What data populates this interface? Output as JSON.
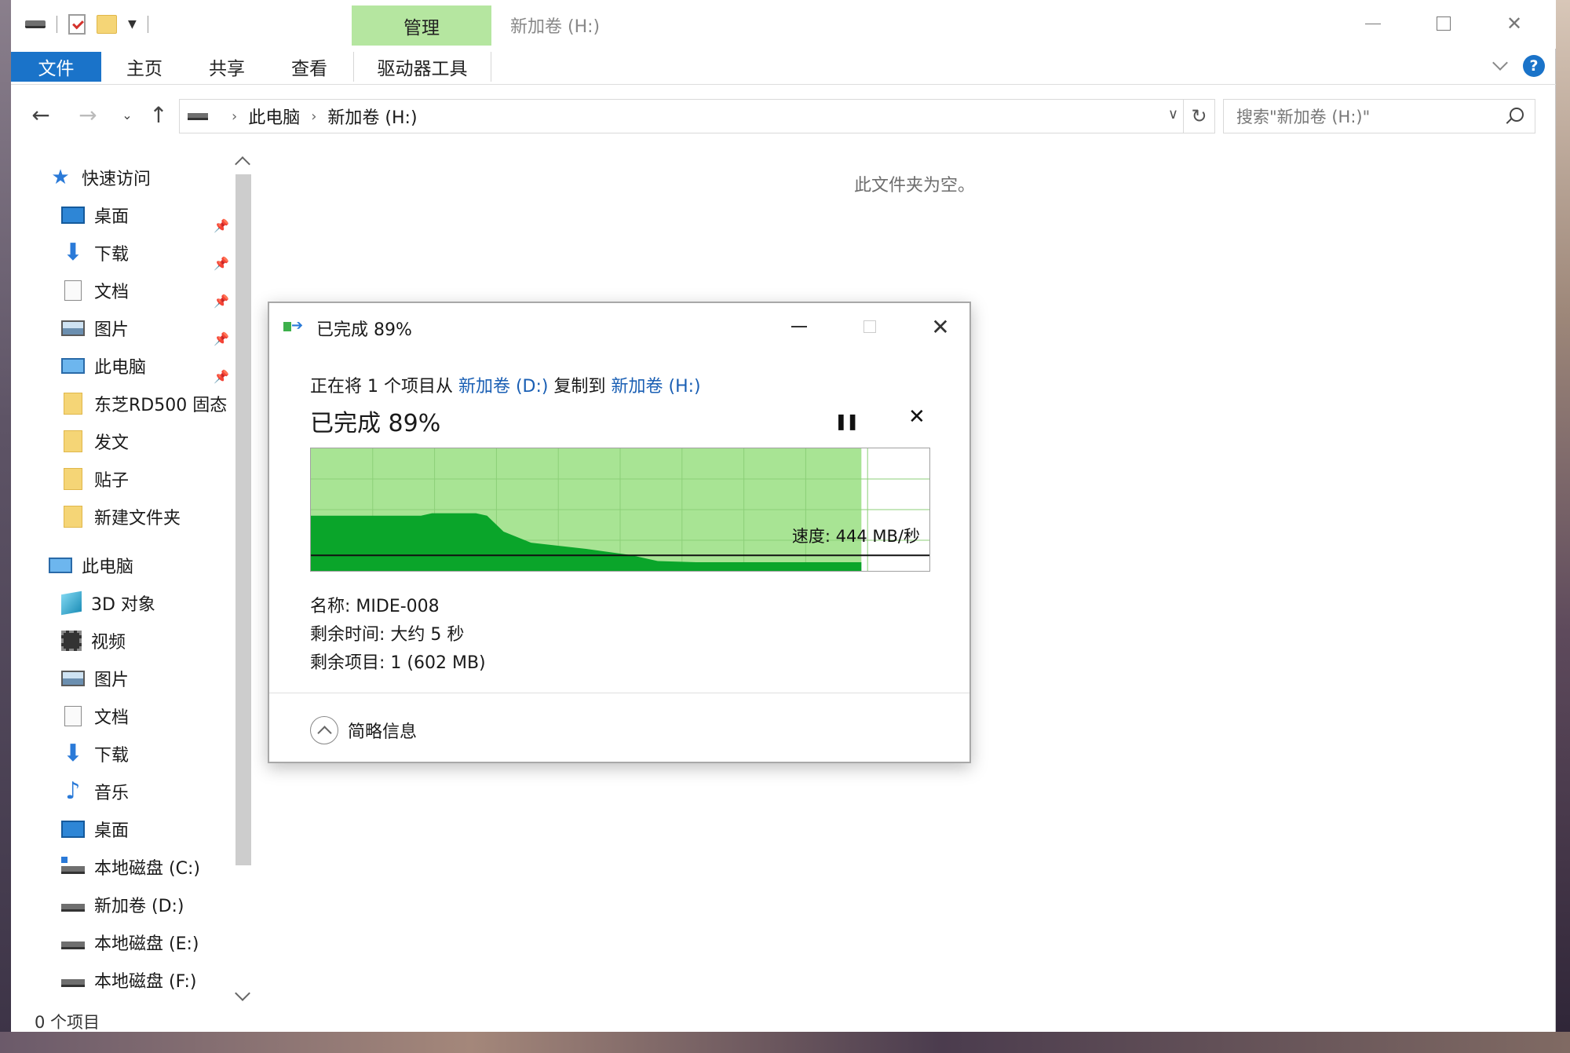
{
  "window": {
    "title": "新加卷 (H:)",
    "manage_tab": "管理"
  },
  "ribbon": {
    "tabs": [
      "文件",
      "主页",
      "共享",
      "查看",
      "驱动器工具"
    ]
  },
  "address": {
    "crumbs": [
      "此电脑",
      "新加卷 (H:)"
    ],
    "search_placeholder": "搜索\"新加卷 (H:)\""
  },
  "nav": {
    "quick_access": "快速访问",
    "quick_items": [
      "桌面",
      "下载",
      "文档",
      "图片",
      "此电脑",
      "东芝RD500 固态",
      "发文",
      "贴子",
      "新建文件夹"
    ],
    "this_pc": "此电脑",
    "pc_items": [
      "3D 对象",
      "视频",
      "图片",
      "文档",
      "下载",
      "音乐",
      "桌面",
      "本地磁盘 (C:)",
      "新加卷 (D:)",
      "本地磁盘 (E:)",
      "本地磁盘 (F:)"
    ]
  },
  "content": {
    "empty_message": "此文件夹为空。"
  },
  "status": {
    "item_count": "0 个项目"
  },
  "dialog": {
    "title": "已完成 89%",
    "copy_prefix": "正在将 1 个项目从",
    "source": "新加卷 (D:)",
    "copy_middle": "复制到",
    "dest": "新加卷 (H:)",
    "percent_text": "已完成 89%",
    "progress": 0.89,
    "speed": "速度: 444 MB/秒",
    "name": "名称: MIDE-008",
    "time_left": "剩余时间: 大约 5 秒",
    "items_left": "剩余项目: 1 (602 MB)",
    "less_details": "简略信息",
    "colors": {
      "progress_fill": "#a8e494",
      "speed_fill": "#0aa52a"
    }
  }
}
